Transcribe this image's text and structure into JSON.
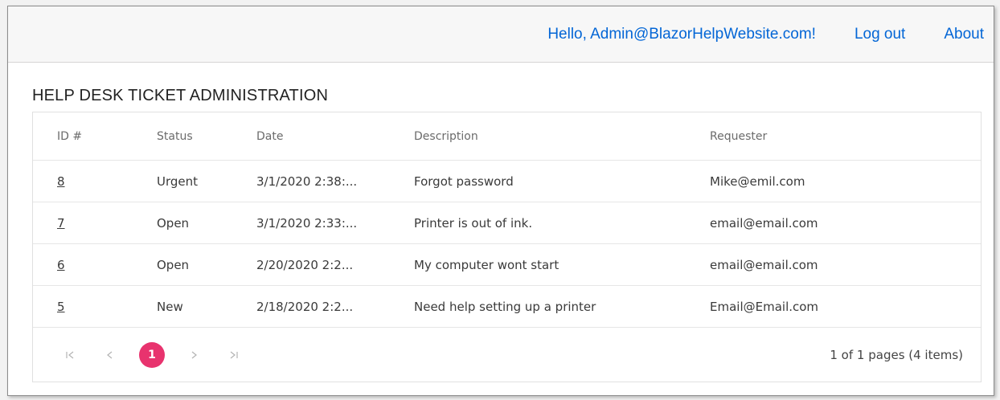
{
  "nav": {
    "greeting": "Hello, Admin@BlazorHelpWebsite.com!",
    "logout": "Log out",
    "about": "About"
  },
  "page": {
    "title": "HELP DESK TICKET ADMINISTRATION"
  },
  "table": {
    "headers": {
      "id": "ID #",
      "status": "Status",
      "date": "Date",
      "description": "Description",
      "requester": "Requester"
    },
    "rows": [
      {
        "id": "8",
        "status": "Urgent",
        "date": "3/1/2020 2:38:...",
        "description": "Forgot password",
        "requester": "Mike@emil.com"
      },
      {
        "id": "7",
        "status": "Open",
        "date": "3/1/2020 2:33:...",
        "description": "Printer is out of ink.",
        "requester": "email@email.com"
      },
      {
        "id": "6",
        "status": "Open",
        "date": "2/20/2020 2:2...",
        "description": "My computer wont start",
        "requester": "email@email.com"
      },
      {
        "id": "5",
        "status": "New",
        "date": "2/18/2020 2:2...",
        "description": "Need help setting up a printer",
        "requester": "Email@Email.com"
      }
    ]
  },
  "pager": {
    "first_icon": "first-page-icon",
    "prev_icon": "previous-page-icon",
    "current_page": "1",
    "next_icon": "next-page-icon",
    "last_icon": "last-page-icon",
    "summary": "1 of 1 pages (4 items)",
    "active_color": "#e8336e"
  },
  "colors": {
    "link": "#0366d6"
  }
}
